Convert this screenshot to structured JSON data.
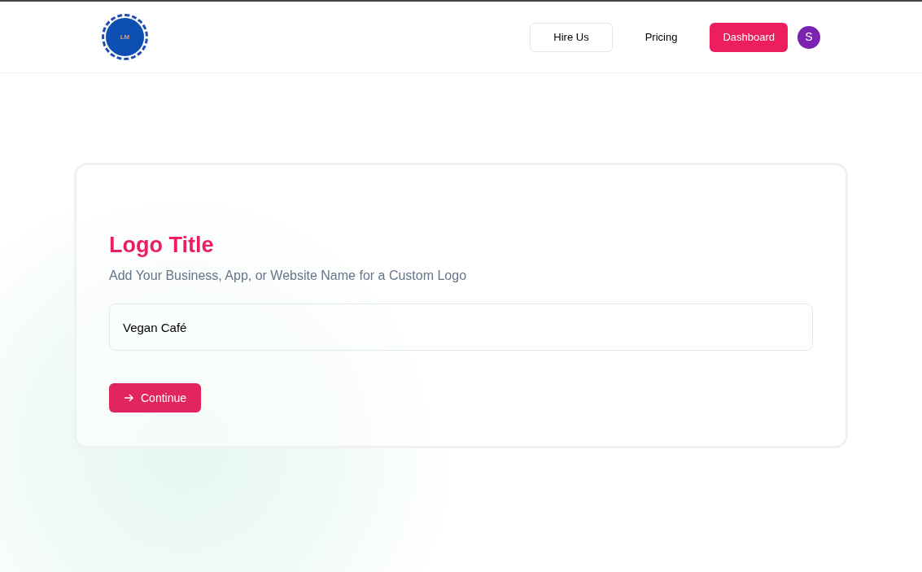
{
  "header": {
    "logo_text": "LM",
    "nav": [
      {
        "label": "Hire Us",
        "kind": "outline"
      },
      {
        "label": "Pricing",
        "kind": "plain"
      },
      {
        "label": "Dashboard",
        "kind": "primary"
      }
    ],
    "avatar": "S"
  },
  "card": {
    "title": "Logo Title",
    "subtitle": "Add Your Business, App, or Website Name for a Custom Logo",
    "input": {
      "value": "Vegan Café"
    },
    "button": "Continue"
  }
}
